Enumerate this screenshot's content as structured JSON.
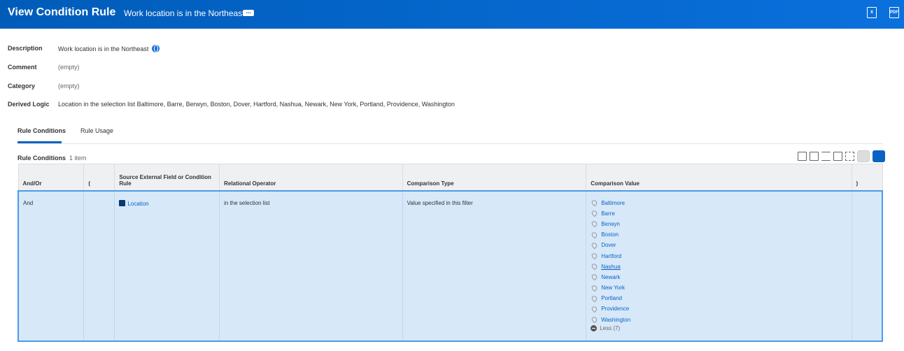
{
  "header": {
    "title": "View Condition Rule",
    "subtitle": "Work location is in the Northeast",
    "excel_icon": "excel-export-icon",
    "pdf_label": "PDF"
  },
  "fields": [
    {
      "label": "Description",
      "value": "Work location is in the Northeast"
    },
    {
      "label": "Comment",
      "value": "(empty)"
    },
    {
      "label": "Category",
      "value": "(empty)"
    },
    {
      "label": "Derived Logic",
      "value": "Location in the selection list Baltimore, Barre, Berwyn, Boston, Dover, Hartford, Nashua, Newark, New York, Portland, Providence, Washington"
    }
  ],
  "tabs": [
    {
      "label": "Rule Conditions"
    },
    {
      "label": "Rule Usage"
    }
  ],
  "grid": {
    "title": "Rule Conditions",
    "count": "1 item",
    "columns": [
      "And/Or",
      "(",
      "Source External Field or Condition Rule",
      "Relational Operator",
      "Comparison Type",
      "Comparison Value",
      ")"
    ],
    "row": {
      "and_or": "And",
      "open": "",
      "source": "Location",
      "operator": "in the selection list",
      "type": "Value specified in this filter",
      "values": [
        "Baltimore",
        "Barre",
        "Berwyn",
        "Boston",
        "Dover",
        "Hartford",
        "Nashua",
        "Newark",
        "New York",
        "Portland",
        "Providence",
        "Washington"
      ],
      "less": "Less (7)",
      "close": ""
    }
  }
}
